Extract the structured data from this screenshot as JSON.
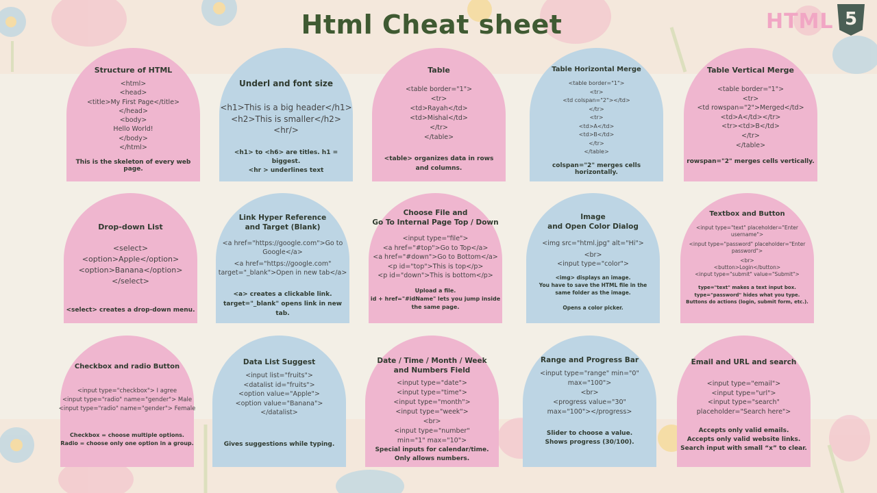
{
  "header": {
    "title": "Html Cheat sheet",
    "logo_text": "HTML",
    "logo_badge": "5"
  },
  "cards": [
    {
      "title": "Structure of HTML",
      "code": [
        "<html>",
        "<head>",
        "<title>My First Page</title>",
        "</head>",
        "<body>",
        "Hello World!",
        "</body>",
        "</html>"
      ],
      "note": "This is the skeleton of every web page."
    },
    {
      "title": "Underl and font size",
      "code": [
        "<h1>This is a big header</h1>",
        "<h2>This is smaller</h2>",
        "<hr/>"
      ],
      "note": "<h1> to <h6> are titles. h1 = biggest.\n<hr > underlines text"
    },
    {
      "title": "Table",
      "code": [
        "<table border=\"1\">",
        "<tr>",
        "<td>Rayah</td>",
        "<td>Mishal</td>",
        "</tr>",
        "</table>"
      ],
      "note": "<table> organizes data in rows\nand columns."
    },
    {
      "title": "Table Horizontal Merge",
      "code": [
        "<table border=\"1\">",
        "<tr>",
        "<td colspan=\"2\"></td>",
        "</tr>",
        "<tr>",
        "<td>A</td>",
        "<td>B</td>",
        "</tr>",
        "</table>"
      ],
      "note": "colspan=\"2\" merges cells horizontally."
    },
    {
      "title": "Table Vertical Merge",
      "code": [
        "<table border=\"1\">",
        "<tr>",
        "<td rowspan=\"2\">Merged</td>",
        "<td>A</td></tr>",
        "<tr><td>B</td>",
        "</tr>",
        "</table>"
      ],
      "note": "rowspan=\"2\" merges cells vertically."
    },
    {
      "title": "Drop-down List",
      "code": [
        "<select>",
        "<option>Apple</option>",
        "<option>Banana</option>",
        "</select>"
      ],
      "note": "<select> creates a drop-down menu."
    },
    {
      "title": "Link Hyper Reference\nand Target (Blank)",
      "code": [
        "<a href=\"https://google.com\">Go to",
        "Google</a>",
        "",
        "<a href=\"https://google.com\"",
        "target=\"_blank\">Open in new tab</a>"
      ],
      "note": "<a> creates a clickable link.\ntarget=\"_blank\" opens link in new tab."
    },
    {
      "title": "Choose File and\nGo To Internal Page Top / Down",
      "code": [
        "<input type=\"file\">",
        "<a href=\"#top\">Go to Top</a>",
        "<a href=\"#down\">Go to Bottom</a>",
        "<p id=\"top\">This is top</p>",
        "<p id=\"down\">This is bottom</p>"
      ],
      "note": "Upload a file.\nid + href=\"#idName\" lets you jump inside\nthe same page."
    },
    {
      "title": "Image\nand Open Color Dialog",
      "code": [
        "<img src=\"html.jpg\" alt=\"Hi\">",
        "",
        "<br>",
        "<input type=\"color\">"
      ],
      "note": "<img> displays an image.\nYou have to save the HTML file in the\nsame folder as the image.\n\nOpens a color picker."
    },
    {
      "title": "Textbox and Button",
      "code": [
        "<input type=\"text\" placeholder=\"Enter",
        "username\">",
        "",
        "<input type=\"password\" placeholder=\"Enter",
        "password\">",
        "",
        "<br>",
        "<button>Login</button>",
        "<input type=\"submit\" value=\"Submit\">"
      ],
      "note": "type=\"text\" makes a text input box.\ntype=\"password\" hides what you type.\nButtons do actions (login, submit form, etc.)."
    },
    {
      "title": "Checkbox and radio Button",
      "code": [
        "<input type=\"checkbox\"> I agree",
        "<input type=\"radio\" name=\"gender\"> Male",
        "<input type=\"radio\" name=\"gender\"> Female"
      ],
      "note": "Checkbox = choose multiple options.\nRadio = choose only one option in a group."
    },
    {
      "title": "Data List Suggest",
      "code": [
        "<input list=\"fruits\">",
        "<datalist id=\"fruits\">",
        "<option value=\"Apple\">",
        "<option value=\"Banana\">",
        "</datalist>"
      ],
      "note": "Gives suggestions while typing."
    },
    {
      "title": "Date / Time / Month / Week\nand Numbers Field",
      "code": [
        "<input type=\"date\">",
        "<input type=\"time\">",
        "<input type=\"month\">",
        "<input type=\"week\">",
        "<br>",
        "<input type=\"number\"",
        "min=\"1\" max=\"10\">"
      ],
      "note": "Special inputs for calendar/time.\nOnly allows numbers."
    },
    {
      "title": "Range and  Progress Bar",
      "code": [
        "<input type=\"range\" min=\"0\"",
        "max=\"100\">",
        "<br>",
        "<progress value=\"30\"",
        "max=\"100\"></progress>"
      ],
      "note": "Slider to choose a value.\nShows progress (30/100)."
    },
    {
      "title": "Email and  URL and search",
      "code": [
        "<input type=\"email\">",
        "<input type=\"url\">",
        "<input type=\"search\"",
        "placeholder=\"Search here\">"
      ],
      "note": "Accepts only valid emails.\nAccepts only valid website links.\nSearch input with small “x” to clear."
    }
  ]
}
